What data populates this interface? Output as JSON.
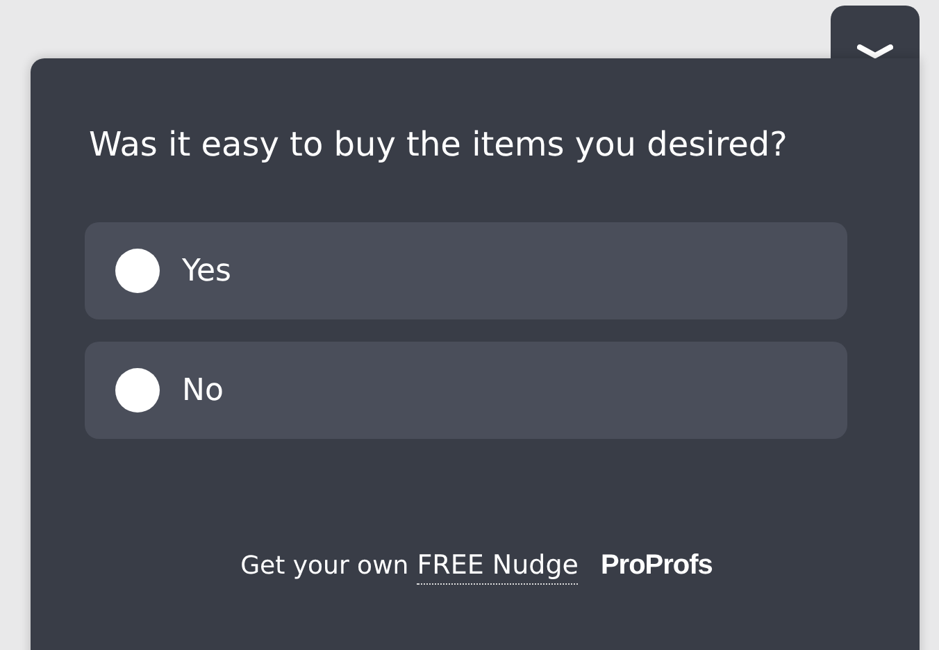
{
  "question": "Was it easy to buy the items you desired?",
  "options": [
    {
      "label": "Yes",
      "selected": false
    },
    {
      "label": "No",
      "selected": false
    }
  ],
  "footer": {
    "text": "Get your own",
    "link": "FREE Nudge",
    "brand": "ProProfs"
  }
}
